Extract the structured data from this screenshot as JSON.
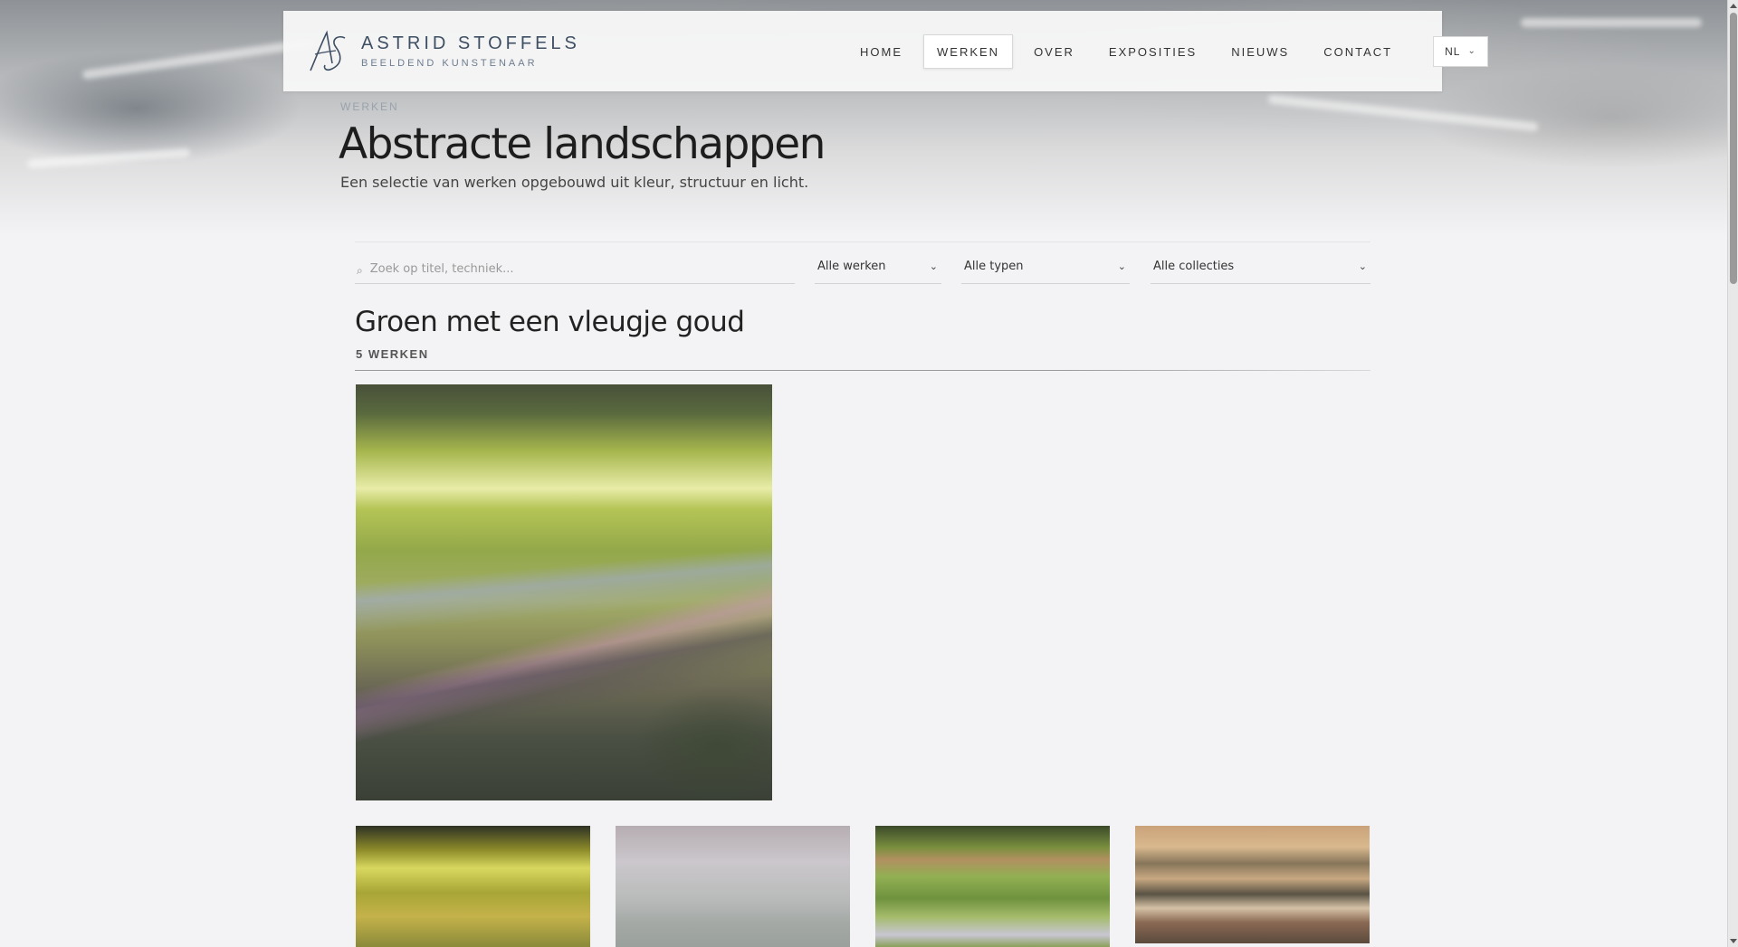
{
  "header": {
    "brand_name": "ASTRID STOFFELS",
    "brand_tagline": "BEELDEND KUNSTENAAR",
    "nav": [
      {
        "label": "HOME",
        "active": false
      },
      {
        "label": "WERKEN",
        "active": true
      },
      {
        "label": "OVER",
        "active": false
      },
      {
        "label": "EXPOSITIES",
        "active": false
      },
      {
        "label": "NIEUWS",
        "active": false
      },
      {
        "label": "CONTACT",
        "active": false
      }
    ],
    "language": "NL"
  },
  "page": {
    "eyebrow": "WERKEN",
    "title": "Abstracte landschappen",
    "subtitle": "Een selectie van werken opgebouwd uit kleur, structuur en licht."
  },
  "filters": {
    "search_placeholder": "Zoek op titel, techniek...",
    "works_select": "Alle werken",
    "types_select": "Alle typen",
    "collections_select": "Alle collecties"
  },
  "collection": {
    "title": "Groen met een vleugje goud",
    "count": "5 WERKEN"
  },
  "icons": {
    "search": "search-icon",
    "chevron": "chevron-down-icon"
  }
}
